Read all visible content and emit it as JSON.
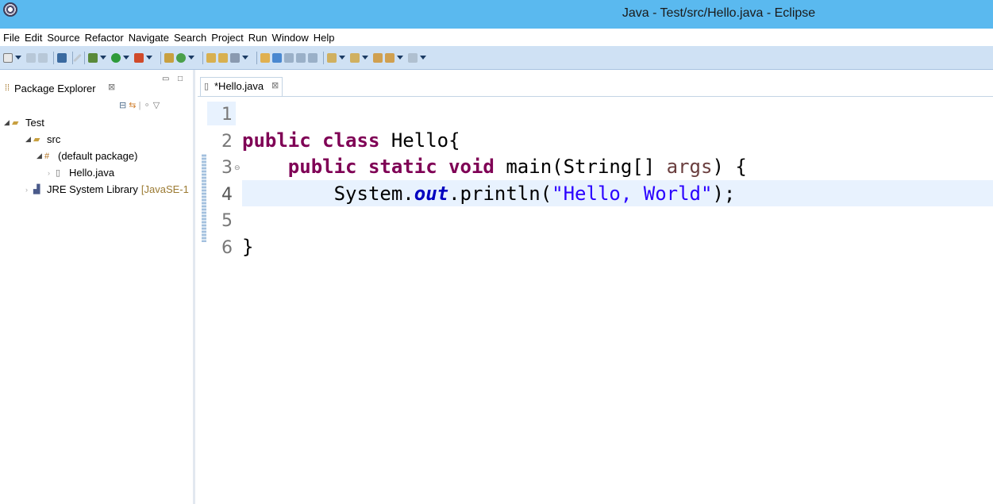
{
  "window": {
    "title": "Java - Test/src/Hello.java - Eclipse"
  },
  "menu": [
    "File",
    "Edit",
    "Source",
    "Refactor",
    "Navigate",
    "Search",
    "Project",
    "Run",
    "Window",
    "Help"
  ],
  "package_explorer": {
    "tab_label": "Package Explorer",
    "close_glyph": "⊠",
    "tree": [
      {
        "label": "Test",
        "twisty": "◢",
        "icon": "folder-project-icon"
      },
      {
        "label": "src",
        "twisty": "◢",
        "icon": "source-folder-icon"
      },
      {
        "label": "(default package)",
        "twisty": "◢",
        "icon": "package-icon"
      },
      {
        "label": "Hello.java",
        "twisty": "›",
        "icon": "java-file-icon"
      },
      {
        "label": "JRE System Library",
        "suffix": "[JavaSE-1",
        "twisty": "›",
        "icon": "library-icon"
      }
    ]
  },
  "editor": {
    "tab_label": "*Hello.java",
    "close_glyph": "⊠",
    "current_line": 4,
    "line_numbers": [
      "1",
      "2",
      "3",
      "4",
      "5",
      "6"
    ],
    "lines": [
      {
        "tokens": []
      },
      {
        "tokens": [
          {
            "t": "public class ",
            "c": "kw"
          },
          {
            "t": "Hello{",
            "c": "plain"
          }
        ]
      },
      {
        "tokens": [
          {
            "t": "    public static void ",
            "c": "kw"
          },
          {
            "t": "main(String[] ",
            "c": "plain"
          },
          {
            "t": "args",
            "c": "param"
          },
          {
            "t": ") {",
            "c": "plain"
          }
        ]
      },
      {
        "tokens": [
          {
            "t": "        System.",
            "c": "plain"
          },
          {
            "t": "out",
            "c": "fld"
          },
          {
            "t": ".println(",
            "c": "plain"
          },
          {
            "t": "\"Hello, World\"",
            "c": "str"
          },
          {
            "t": ");",
            "c": "plain"
          }
        ]
      },
      {
        "tokens": []
      },
      {
        "tokens": [
          {
            "t": "}",
            "c": "plain"
          }
        ]
      }
    ]
  },
  "colors": {
    "titlebar": "#5ab9ef",
    "toolbar": "#cfe1f4",
    "keyword": "#7f0055",
    "string": "#2a00ff",
    "field": "#0000c0",
    "current_line": "#e8f2fe"
  }
}
